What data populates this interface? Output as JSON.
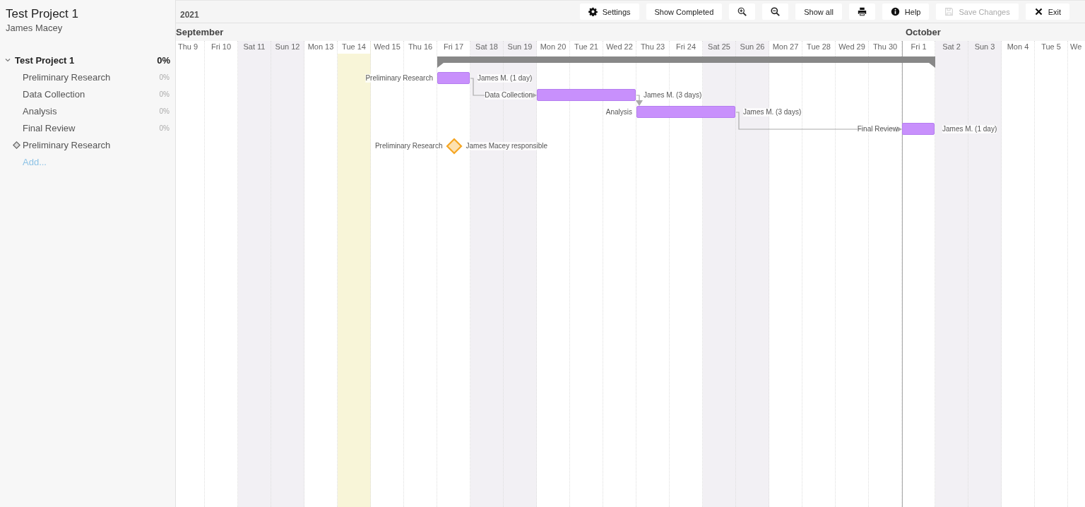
{
  "sidebar": {
    "title": "Test Project 1",
    "user": "James Macey",
    "tree": [
      {
        "name": "Test Project 1",
        "percent": "0%",
        "expanded": true,
        "children": [
          {
            "kind": "task",
            "name": "Preliminary Research",
            "percent": "0%"
          },
          {
            "kind": "task",
            "name": "Data Collection",
            "percent": "0%"
          },
          {
            "kind": "task",
            "name": "Analysis",
            "percent": "0%"
          },
          {
            "kind": "task",
            "name": "Final Review",
            "percent": "0%"
          },
          {
            "kind": "milestone",
            "name": "Preliminary Research"
          }
        ]
      }
    ],
    "add_link": "Add..."
  },
  "year": "2021",
  "toolbar": [
    {
      "kind": "settings",
      "label": "Settings",
      "disabled": false
    },
    {
      "kind": "text",
      "label": "Show Completed",
      "disabled": false
    },
    {
      "kind": "zoom-in",
      "disabled": false
    },
    {
      "kind": "zoom-out",
      "disabled": false
    },
    {
      "kind": "text",
      "label": "Show all",
      "disabled": false
    },
    {
      "kind": "print",
      "disabled": false
    },
    {
      "kind": "help",
      "label": "Help",
      "disabled": false
    },
    {
      "kind": "save",
      "label": "Save Changes",
      "disabled": true
    },
    {
      "kind": "exit",
      "label": "Exit",
      "disabled": false
    }
  ],
  "months": [
    {
      "label": "September"
    },
    {
      "label": "October"
    }
  ],
  "days": [
    {
      "label": "Thu 9",
      "weekend": false,
      "today": false
    },
    {
      "label": "Fri 10",
      "weekend": false,
      "today": false
    },
    {
      "label": "Sat 11",
      "weekend": true,
      "today": false
    },
    {
      "label": "Sun 12",
      "weekend": true,
      "today": false
    },
    {
      "label": "Mon 13",
      "weekend": false,
      "today": false
    },
    {
      "label": "Tue 14",
      "weekend": false,
      "today": true
    },
    {
      "label": "Wed 15",
      "weekend": false,
      "today": false
    },
    {
      "label": "Thu 16",
      "weekend": false,
      "today": false
    },
    {
      "label": "Fri 17",
      "weekend": false,
      "today": false
    },
    {
      "label": "Sat 18",
      "weekend": true,
      "today": false
    },
    {
      "label": "Sun 19",
      "weekend": true,
      "today": false
    },
    {
      "label": "Mon 20",
      "weekend": false,
      "today": false
    },
    {
      "label": "Tue 21",
      "weekend": false,
      "today": false
    },
    {
      "label": "Wed 22",
      "weekend": false,
      "today": false
    },
    {
      "label": "Thu 23",
      "weekend": false,
      "today": false
    },
    {
      "label": "Fri 24",
      "weekend": false,
      "today": false
    },
    {
      "label": "Sat 25",
      "weekend": true,
      "today": false
    },
    {
      "label": "Sun 26",
      "weekend": true,
      "today": false
    },
    {
      "label": "Mon 27",
      "weekend": false,
      "today": false
    },
    {
      "label": "Tue 28",
      "weekend": false,
      "today": false
    },
    {
      "label": "Wed 29",
      "weekend": false,
      "today": false
    },
    {
      "label": "Thu 30",
      "weekend": false,
      "today": false
    },
    {
      "label": "Fri 1",
      "weekend": false,
      "today": false
    },
    {
      "label": "Sat 2",
      "weekend": true,
      "today": false
    },
    {
      "label": "Sun 3",
      "weekend": true,
      "today": false
    },
    {
      "label": "Mon 4",
      "weekend": false,
      "today": false
    },
    {
      "label": "Tue 5",
      "weekend": false,
      "today": false
    },
    {
      "label": "We",
      "weekend": false,
      "today": false
    }
  ],
  "bars": [
    {
      "kind": "task",
      "name": "Preliminary Research",
      "assignee": "James M. (1 day)"
    },
    {
      "kind": "task",
      "name": "Data Collection",
      "assignee": "James M. (3 days)"
    },
    {
      "kind": "task",
      "name": "Analysis",
      "assignee": "James M. (3 days)"
    },
    {
      "kind": "task",
      "name": "Final Review",
      "assignee": "James M. (1 day)"
    },
    {
      "kind": "milestone",
      "name": "Preliminary Research",
      "assignee": "James Macey responsible"
    }
  ]
}
